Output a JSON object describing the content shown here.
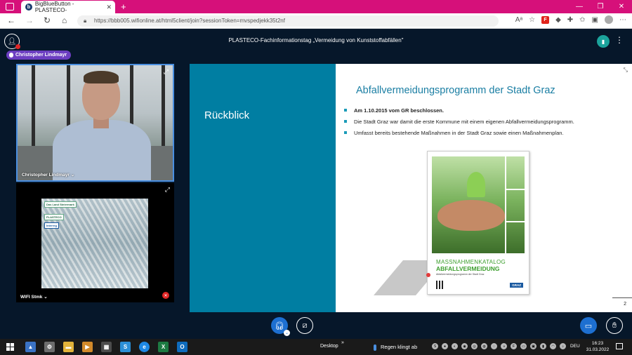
{
  "browser": {
    "tab_title": "BigBlueButton - PLASTECO-",
    "tab_favicon": "b",
    "url": "https://bbb005.wifionline.at/html5client/join?sessionToken=mvspedjekk35t2nf",
    "zoom_label": "Aᵃ"
  },
  "meeting": {
    "title": "PLASTECO-Fachinformationstag „Vermeidung von Kunststoffabfällen\"",
    "talking_user": "Christopher Lindmayr"
  },
  "webcams": [
    {
      "name": "Christopher Lindmayr",
      "has_menu": true
    },
    {
      "name": "WIFI Stmk",
      "has_menu": true
    }
  ],
  "bale_logos": [
    "Das Land Steiermark",
    "PLASTECO",
    "Interreg"
  ],
  "slide": {
    "left_title": "Rückblick",
    "title": "Abfallvermeidungsprogramm der Stadt Graz",
    "bullets": [
      {
        "text": "Am 1.10.2015 vom GR beschlossen.",
        "bold": true
      },
      {
        "text": "Die Stadt Graz war damit die erste Kommune mit einem eigenen Abfallvermeidungsprogramm.",
        "bold": false
      },
      {
        "text": "Umfasst bereits bestehende Maßnahmen in der Stadt Graz sowie einen Maßnahmenplan.",
        "bold": false
      }
    ],
    "book_line1": "MASSNAHMENKATALOG",
    "book_line2": "ABFALLVERMEIDUNG",
    "book_line3": "Abfallvermeidungsprogramm der Stadt Graz",
    "book_brand": "GRAZ",
    "page_number": "2"
  },
  "taskbar": {
    "desktop_label": "Desktop",
    "weather": "Regen klingt ab",
    "language": "DEU",
    "time": "16:23",
    "date": "31.03.2022"
  },
  "colors": {
    "browser_accent": "#d6107a",
    "bbb_background": "#06172a",
    "slide_teal": "#007ea2",
    "title_blue": "#1a7ea3",
    "talking_badge": "#6c3ec1",
    "button_blue": "#1d6fd1"
  }
}
